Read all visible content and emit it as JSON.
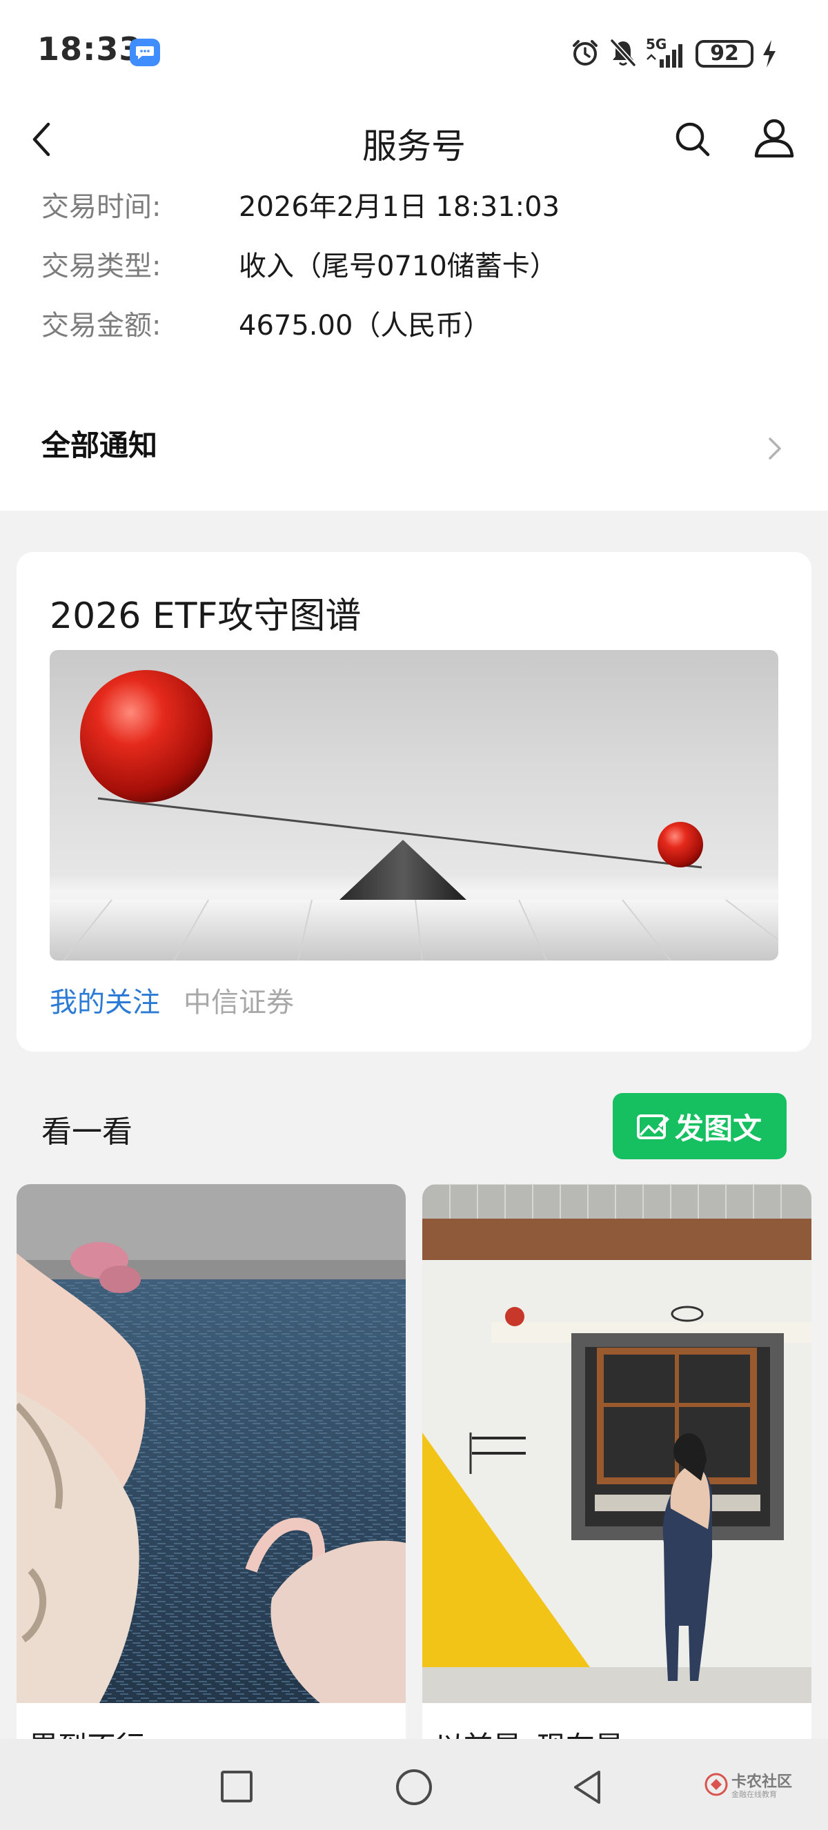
{
  "status_bar": {
    "time": "18:33",
    "network": "5G",
    "battery": "92",
    "icons": [
      "message-icon",
      "alarm-icon",
      "mute-icon",
      "signal-icon",
      "battery-icon",
      "charging-icon"
    ]
  },
  "header": {
    "title": "服务号",
    "icons": [
      "back-icon",
      "search-icon",
      "profile-icon"
    ]
  },
  "transaction": {
    "rows": [
      {
        "label": "交易时间:",
        "value": "2026年2月1日 18:31:03"
      },
      {
        "label": "交易类型:",
        "value": "收入（尾号0710储蓄卡）"
      },
      {
        "label": "交易金额:",
        "value": "4675.00（人民币）"
      }
    ],
    "all_notices": "全部通知"
  },
  "article": {
    "title": "2026 ETF攻守图谱",
    "tag": "我的关注",
    "source": "中信证券"
  },
  "feed": {
    "heading": "看一看",
    "post_button": "发图文",
    "cards": [
      {
        "caption": "累到不行"
      },
      {
        "caption": "以前是s现在是m"
      }
    ]
  },
  "watermark": {
    "text": "卡农社区",
    "sub": "金融在线教育"
  },
  "colors": {
    "accent_green": "#16c060",
    "link_blue": "#2b7bd6",
    "status_blue": "#3f8dff"
  }
}
